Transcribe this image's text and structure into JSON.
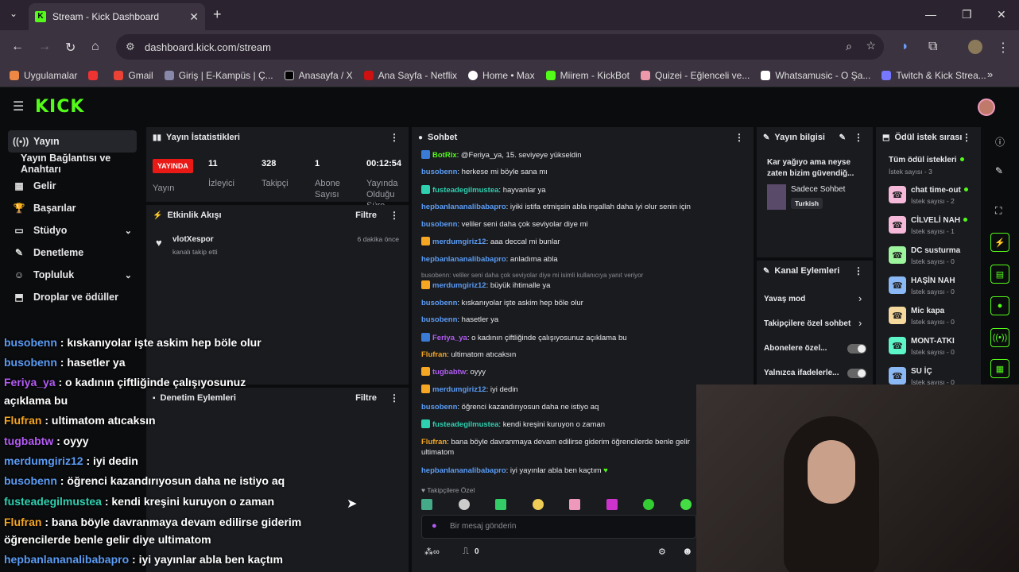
{
  "browser": {
    "tab_title": "Stream - Kick Dashboard",
    "url": "dashboard.kick.com/stream",
    "bookmarks": [
      "Uygulamalar",
      "Gmail",
      "Giriş | E-Kampüs | Ç...",
      "Anasayfa / X",
      "Ana Sayfa - Netflix",
      "Home • Max",
      "Miirem - KickBot",
      "Quizei - Eğlenceli ve...",
      "Whatsamusic - O Şa...",
      "Twitch & Kick Strea..."
    ]
  },
  "colors": {
    "brand": "#53fc18",
    "live": "#e91916",
    "panel": "#191b1f"
  },
  "sidebar": {
    "items": [
      {
        "label": "Yayın",
        "icon": "broadcast-icon"
      },
      {
        "label": "Yayın Bağlantısı ve Anahtarı",
        "icon": ""
      },
      {
        "label": "Gelir",
        "icon": "revenue-icon"
      },
      {
        "label": "Başarılar",
        "icon": "trophy-icon"
      },
      {
        "label": "Stüdyo",
        "icon": "studio-icon"
      },
      {
        "label": "Denetleme",
        "icon": "wrench-icon"
      },
      {
        "label": "Topluluk",
        "icon": "community-icon"
      },
      {
        "label": "Droplar ve ödüller",
        "icon": "drops-icon"
      }
    ]
  },
  "stats": {
    "title": "Yayın İstatistikleri",
    "live_badge": "YAYINDA",
    "live_label": "Yayın",
    "viewers": {
      "value": "11",
      "label": "İzleyici"
    },
    "followers": {
      "value": "328",
      "label": "Takipçi"
    },
    "subs": {
      "value": "1",
      "label": "Abone Sayısı"
    },
    "uptime": {
      "value": "00:12:54",
      "label": "Yayında Olduğu Süre"
    }
  },
  "activity": {
    "title": "Etkinlik Akışı",
    "filter": "Filtre",
    "event_user": "vlotXespor",
    "event_text": "kanalı takip etti",
    "event_time": "6 dakika önce"
  },
  "moderation": {
    "title": "Denetim Eylemleri",
    "filter": "Filtre"
  },
  "chat": {
    "title": "Sohbet",
    "lines": [
      {
        "user": "BotRix",
        "color": "#53fc18",
        "text": ": @Feriya_ya, 15. seviyeye yükseldin"
      },
      {
        "user": "busobenn",
        "color": "#5b9cf5",
        "text": ": herkese mi böyle sana mı"
      },
      {
        "user": "fusteadegilmustea",
        "color": "#2fd0b0",
        "text": ": hayvanlar ya"
      },
      {
        "user": "hepbanlananalibabapro",
        "color": "#5b9cf5",
        "text": ": iyiki istifa etmişsin abla inşallah daha iyi olur senin için"
      },
      {
        "user": "busobenn",
        "color": "#5b9cf5",
        "text": ": veliler seni daha çok seviyolar diye mi"
      },
      {
        "user": "merdumgiriz12",
        "color": "#5b9cf5",
        "text": ": aaa deccal mi bunlar"
      },
      {
        "user": "hepbanlananalibabapro",
        "color": "#5b9cf5",
        "text": ": anladıma abla"
      },
      {
        "user": "merdumgiriz12",
        "color": "#5b9cf5",
        "text": ": büyük ihtimalle ya"
      },
      {
        "user": "busobenn",
        "color": "#5b9cf5",
        "text": ": kıskanıyolar işte askim hep böle olur"
      },
      {
        "user": "busobenn",
        "color": "#5b9cf5",
        "text": ": hasetler ya"
      },
      {
        "user": "Feriya_ya",
        "color": "#b45cf5",
        "text": ": o kadının çiftliğinde çalışıyosunuz açıklama bu"
      },
      {
        "user": "Flufran",
        "color": "#f5a623",
        "text": ": ultimatom atıcaksın"
      },
      {
        "user": "tugbabtw",
        "color": "#b45cf5",
        "text": ": oyyy"
      },
      {
        "user": "merdumgiriz12",
        "color": "#5b9cf5",
        "text": ": iyi dedin"
      },
      {
        "user": "busobenn",
        "color": "#5b9cf5",
        "text": ": öğrenci kazandırıyosun daha ne istiyo aq"
      },
      {
        "user": "fusteadegilmustea",
        "color": "#2fd0b0",
        "text": ": kendi kreşini kuruyon o zaman"
      },
      {
        "user": "Flufran",
        "color": "#f5a623",
        "text": ": bana böyle davranmaya devam edilirse giderim öğrencilerde benle gelir ultimatom"
      },
      {
        "user": "hepbanlananalibabapro",
        "color": "#5b9cf5",
        "text": ": iyi yayınlar abla ben kaçtım"
      }
    ],
    "reply_note": "busobenn: veliler seni daha çok seviyolar diye mi isimli kullanıcıya yanıt veriyor",
    "followers_only": "Takipçilere Özel",
    "input_placeholder": "Bir mesaj gönderin",
    "footer_count": "0"
  },
  "overlay_chat": [
    {
      "user": "busobenn",
      "color": "#5b9cf5",
      "text": " : kıskanıyolar işte askim hep böle olur"
    },
    {
      "user": "busobenn",
      "color": "#5b9cf5",
      "text": " : hasetler ya"
    },
    {
      "user": "Feriya_ya",
      "color": "#b45cf5",
      "text": " : o kadının çiftliğinde çalışıyosunuz"
    },
    {
      "user": "",
      "color": "#fff",
      "text": "açıklama bu"
    },
    {
      "user": "Flufran",
      "color": "#f5a623",
      "text": " : ultimatom atıcaksın"
    },
    {
      "user": "tugbabtw",
      "color": "#b45cf5",
      "text": " : oyyy"
    },
    {
      "user": "merdumgiriz12",
      "color": "#5b9cf5",
      "text": " : iyi dedin"
    },
    {
      "user": "busobenn",
      "color": "#5b9cf5",
      "text": " : öğrenci kazandırıyosun daha ne istiyo aq"
    },
    {
      "user": "fusteadegilmustea",
      "color": "#2fd0b0",
      "text": " : kendi kreşini kuruyon o zaman"
    },
    {
      "user": "Flufran",
      "color": "#f5a623",
      "text": " : bana böyle davranmaya devam edilirse giderim"
    },
    {
      "user": "",
      "color": "#fff",
      "text": "öğrencilerde benle gelir diye ultimatom"
    },
    {
      "user": "hepbanlananalibabapro",
      "color": "#5b9cf5",
      "text": " : iyi yayınlar abla ben kaçtım"
    }
  ],
  "stream_info": {
    "title": "Yayın bilgisi",
    "stream_title": "Kar yağıyo ama neyse zaten bizim güvendiğ...",
    "category": "Sadece Sohbet",
    "language": "Turkish"
  },
  "channel_actions": {
    "title": "Kanal Eylemleri",
    "items": [
      "Yavaş mod",
      "Takipçilere özel sohbet",
      "Abonelere özel...",
      "Yalnızca ifadelerle..."
    ]
  },
  "rewards": {
    "title": "Ödül istek sırası",
    "all_label": "Tüm ödül istekleri",
    "all_count": "İstek sayısı - 3",
    "items": [
      {
        "name": "chat time-out",
        "count": "İstek sayısı - 2",
        "color": "#f5b8d8",
        "active": true
      },
      {
        "name": "CİLVELİ NAH",
        "count": "İstek sayısı - 1",
        "color": "#f5b8d8",
        "active": true
      },
      {
        "name": "DC susturma",
        "count": "İstek sayısı - 0",
        "color": "#9cf59c",
        "active": false
      },
      {
        "name": "HAŞİN NAH",
        "count": "İstek sayısı - 0",
        "color": "#8ab8f5",
        "active": false
      },
      {
        "name": "Mic kapa",
        "count": "İstek sayısı - 0",
        "color": "#f5d89c",
        "active": false
      },
      {
        "name": "MONT-ATKI",
        "count": "İstek sayısı - 0",
        "color": "#5cf5c8",
        "active": false
      },
      {
        "name": "SU İÇ",
        "count": "İstek sayısı - 0",
        "color": "#8ab8f5",
        "active": false
      }
    ]
  }
}
